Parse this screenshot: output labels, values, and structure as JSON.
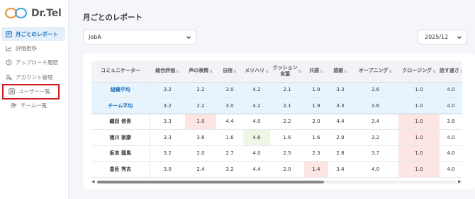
{
  "app": {
    "name": "Dr.Tel"
  },
  "sidebar": {
    "items": [
      {
        "label": "月ごとのレポート",
        "icon": "report-icon"
      },
      {
        "label": "評価推移",
        "icon": "chart-icon"
      },
      {
        "label": "アップロード履歴",
        "icon": "history-icon"
      },
      {
        "label": "アカウント管理",
        "icon": "account-icon"
      },
      {
        "label": "ユーザー一覧",
        "icon": "user-list-icon"
      },
      {
        "label": "チーム一覧",
        "icon": "team-icon"
      }
    ]
  },
  "page": {
    "title": "月ごとのレポート"
  },
  "filters": {
    "job": "JobA",
    "month": "2025/12"
  },
  "table": {
    "headers": [
      "コミュニケーター",
      "総合評価",
      "声の表情",
      "自信",
      "メリハリ",
      "クッション\n言葉",
      "共感",
      "感謝",
      "オープニング",
      "クロージング",
      "話す速さ"
    ],
    "aggregates": [
      {
        "name": "組織平均",
        "values": [
          "3.2",
          "2.2",
          "3.0",
          "4.2",
          "2.1",
          "1.9",
          "3.3",
          "3.6",
          "1.0",
          "4.0"
        ]
      },
      {
        "name": "チーム平均",
        "values": [
          "3.2",
          "2.2",
          "3.0",
          "4.2",
          "2.1",
          "1.9",
          "3.3",
          "3.6",
          "1.0",
          "4.0"
        ]
      }
    ],
    "rows": [
      {
        "name": "織田 信長",
        "values": [
          "3.3",
          "1.0",
          "4.4",
          "4.0",
          "2.2",
          "2.0",
          "4.4",
          "3.4",
          "1.0",
          "3.8"
        ]
      },
      {
        "name": "徳川 家康",
        "values": [
          "3.3",
          "3.6",
          "1.6",
          "4.6",
          "1.6",
          "1.6",
          "2.8",
          "3.2",
          "1.0",
          "4.0"
        ]
      },
      {
        "name": "坂本 龍馬",
        "values": [
          "3.2",
          "2.0",
          "2.7",
          "4.0",
          "2.5",
          "2.3",
          "2.8",
          "3.7",
          "1.0",
          "4.0"
        ]
      },
      {
        "name": "豊臣 秀吉",
        "values": [
          "3.0",
          "2.4",
          "3.2",
          "4.4",
          "2.0",
          "1.4",
          "3.4",
          "4.0",
          "1.0",
          "4.0"
        ]
      }
    ]
  },
  "colors": {
    "accent": "#1d6fb6",
    "low": "#fde5e3",
    "high": "#eef7e6",
    "highlight_box": "#d0181e"
  }
}
